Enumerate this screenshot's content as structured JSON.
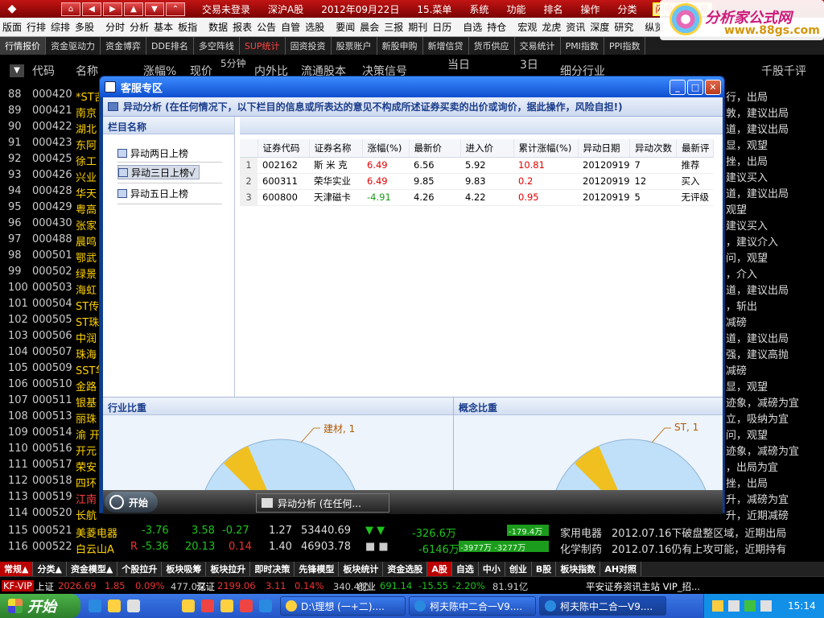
{
  "titlebar": {
    "nav_buttons": [
      "⌂",
      "◀",
      "▶",
      "▲",
      "▼",
      "⌃"
    ],
    "menu": [
      "交易未登录",
      "深沪A股",
      "2012年09月22日",
      "15.菜单",
      "系统",
      "功能",
      "排名",
      "操作",
      "分类"
    ],
    "flash_buttons": [
      "闪电手",
      "交易"
    ]
  },
  "menubar": [
    "版面",
    "行排",
    "综排",
    "多股",
    "|",
    "分时",
    "分析",
    "基本",
    "板指",
    "|",
    "数据",
    "报表",
    "公告",
    "自管",
    "选股",
    "|",
    "要闻",
    "晨会",
    "三报",
    "期刊",
    "日历",
    "|",
    "自选",
    "持仓",
    "|",
    "宏观",
    "龙虎",
    "资讯",
    "深度",
    "研究",
    "|",
    "纵览"
  ],
  "tabs": [
    "行情报价",
    "资金驱动力",
    "资金博弈",
    "DDE排名",
    "多空阵线",
    "SUP统计",
    "固资投资",
    "股票账户",
    "新股申购",
    "新增信贷",
    "货币供应",
    "交易统计",
    "PMI指数",
    "PPI指数"
  ],
  "columns": [
    "代码",
    "名称",
    "涨幅%",
    "现价",
    "5分钟",
    "内外比",
    "流通股本",
    "决策信号",
    "当日",
    "3日",
    "细分行业",
    "千股千评"
  ],
  "rows": [
    {
      "n": "88",
      "code": "000420",
      "name": "*ST吉",
      "right": "行，出局"
    },
    {
      "n": "89",
      "code": "000421",
      "name": "南京",
      "right": "敦，建议出局"
    },
    {
      "n": "90",
      "code": "000422",
      "name": "湖北",
      "right": "道，建议出局"
    },
    {
      "n": "91",
      "code": "000423",
      "name": "东阿",
      "right": "显，观望"
    },
    {
      "n": "92",
      "code": "000425",
      "name": "徐工",
      "right": "挫，出局"
    },
    {
      "n": "93",
      "code": "000426",
      "name": "兴业",
      "right": "建议买入"
    },
    {
      "n": "94",
      "code": "000428",
      "name": "华天",
      "right": "道，建议出局"
    },
    {
      "n": "95",
      "code": "000429",
      "name": "粤高",
      "right": "观望"
    },
    {
      "n": "96",
      "code": "000430",
      "name": "张家",
      "right": "建议买入"
    },
    {
      "n": "97",
      "code": "000488",
      "name": "晨鸣",
      "right": "，建议介入"
    },
    {
      "n": "98",
      "code": "000501",
      "name": "鄂武",
      "right": "问，观望"
    },
    {
      "n": "99",
      "code": "000502",
      "name": "绿景",
      "right": "，介入"
    },
    {
      "n": "100",
      "code": "000503",
      "name": "海虹",
      "right": "道，建议出局"
    },
    {
      "n": "101",
      "code": "000504",
      "name": "ST传",
      "right": "，斩出"
    },
    {
      "n": "102",
      "code": "000505",
      "name": "ST珠",
      "right": "减磅"
    },
    {
      "n": "103",
      "code": "000506",
      "name": "中润",
      "right": "道，建议出局"
    },
    {
      "n": "104",
      "code": "000507",
      "name": "珠海",
      "right": "强，建议高抛"
    },
    {
      "n": "105",
      "code": "000509",
      "name": "SST华",
      "right": "减磅"
    },
    {
      "n": "106",
      "code": "000510",
      "name": "金路",
      "right": "显，观望"
    },
    {
      "n": "107",
      "code": "000511",
      "name": "银基",
      "right": "迹象，减磅为宜"
    },
    {
      "n": "108",
      "code": "000513",
      "name": "丽珠",
      "right": "立，吸纳为宜"
    },
    {
      "n": "109",
      "code": "000514",
      "name": "渝 开",
      "right": "问，观望"
    },
    {
      "n": "110",
      "code": "000516",
      "name": "开元",
      "right": "迹象，减磅为宜"
    },
    {
      "n": "111",
      "code": "000517",
      "name": "荣安",
      "right": "，出局为宜"
    },
    {
      "n": "112",
      "code": "000518",
      "name": "四环",
      "right": "挫，出局"
    },
    {
      "n": "113",
      "code": "000519",
      "name": "江南",
      "right": "升，减磅为宜"
    },
    {
      "n": "114",
      "code": "000520",
      "name": "长航",
      "right": "升，近期减磅"
    }
  ],
  "full_rows": [
    {
      "n": "115",
      "code": "000521",
      "name": "美菱电器",
      "flag": "",
      "chg": "-3.76",
      "price": "3.58",
      "m5": "-0.27",
      "ratio": "1.27",
      "shares": "53440.69",
      "signal": "▼ ▼",
      "day": "-326.6万",
      "d3": "-179.4万",
      "industry": "家用电器",
      "comment": "2012.07.16下破盘整区域，近期出局"
    },
    {
      "n": "116",
      "code": "000522",
      "name": "白云山A",
      "flag": "R",
      "chg": "-5.36",
      "price": "20.13",
      "m5": "0.14",
      "ratio": "1.40",
      "shares": "46903.78",
      "signal": "■ ■",
      "day": "-6146万",
      "d3": "-3977万 -3277万",
      "industry": "化学制药",
      "comment": "2012.07.16仍有上攻可能，近期持有"
    }
  ],
  "dialog": {
    "title": "客服专区",
    "notice": "异动分析 (在任何情况下，以下栏目的信息或所表达的意见不构成所述证券买卖的出价或询价，据此操作，风险自担!)",
    "left_header": "栏目名称",
    "left_items": [
      "异动两日上榜",
      "异动三日上榜√",
      "异动五日上榜"
    ],
    "table_headers": [
      "证券代码",
      "证券名称",
      "涨幅(%)",
      "最新价",
      "进入价",
      "累计涨幅(%)",
      "异动日期",
      "异动次数",
      "最新评"
    ],
    "table_rows": [
      [
        "1",
        "002162",
        "斯 米 克",
        "6.49",
        "6.56",
        "5.92",
        "10.81",
        "20120919",
        "7",
        "推荐"
      ],
      [
        "2",
        "600311",
        "荣华实业",
        "6.49",
        "9.85",
        "9.83",
        "0.2",
        "20120919",
        "12",
        "买入"
      ],
      [
        "3",
        "600800",
        "天津磁卡",
        "-4.91",
        "4.26",
        "4.22",
        "0.95",
        "20120919",
        "5",
        "无评级"
      ]
    ],
    "industry_title": "行业比重",
    "industry_label": "建材, 1",
    "concept_title": "概念比重",
    "concept_label": "ST, 1",
    "start_label": "开始",
    "task_label": "异动分析 (在任何..."
  },
  "bottom_tabs": [
    "常规▲",
    "分类▲",
    "资金模型▲",
    "个股拉升",
    "板块吸筹",
    "板块拉升",
    "即时决策",
    "先锋模型",
    "板块统计",
    "资金选股",
    "A股",
    "自选",
    "中小",
    "创业",
    "B股",
    "板块指数",
    "AH对照"
  ],
  "ticker": {
    "kf": "KF-VIP",
    "sh_label": "上证",
    "sh_val": "2026.69",
    "sh_chg": "1.85",
    "sh_pct": "0.09%",
    "sh_amt": "477.0亿",
    "sz_label": "深证",
    "sz_val": "2199.06",
    "sz_chg": "3.11",
    "sz_pct": "0.14%",
    "sz_amt": "340.4亿",
    "cy_label": "创业",
    "cy_val": "691.14",
    "cy_chg": "-15.55",
    "cy_pct": "-2.20%",
    "cy_amt": "81.91亿",
    "news": "平安证券资讯主站  VIP_招..."
  },
  "taskbar": {
    "start": "开始",
    "items": [
      "D:\\理想 (一+二)....",
      "柯夫陈中二合一V9....",
      "柯夫陈中二合一V9...."
    ],
    "clock": "15:14"
  },
  "watermark": {
    "title": "分析家公式网",
    "url": "www.88gs.com"
  },
  "colors": {
    "up": "#e00000",
    "down": "#1a9c1a",
    "name": "#ffd200",
    "dialog_blue": "#0e4fcf"
  }
}
